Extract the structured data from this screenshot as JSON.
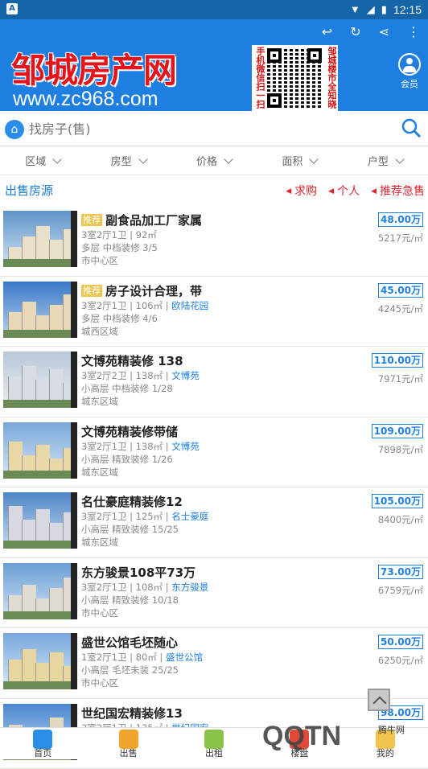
{
  "status_bar": {
    "time": "12:15",
    "app_icon_letter": "A"
  },
  "header": {
    "logo_title": "邹城房产网",
    "logo_url": "www.zc968.com",
    "qr_left_text": "手机微信扫一扫",
    "qr_right_text": "邹城楼市全知晓",
    "member_label": "会员"
  },
  "search": {
    "placeholder": "找房子(售)"
  },
  "filters": [
    "区域",
    "房型",
    "价格",
    "面积",
    "户型"
  ],
  "section": {
    "title": "出售房源",
    "links": [
      "求购",
      "个人",
      "推荐急售"
    ]
  },
  "listings": [
    {
      "tag": "推荐",
      "title": "副食品加工厂家属",
      "line1": "3室2厅1卫 | 92㎡",
      "community": "",
      "line2": "多层 中档装修 3/5",
      "area": "市中心区",
      "price": "48.00万",
      "unit_price": "5217元/㎡"
    },
    {
      "tag": "推荐",
      "title": "房子设计合理，带",
      "line1": "3室2厅1卫 | 106㎡ | ",
      "community": "欧陆花园",
      "line2": "多层 中档装修 4/6",
      "area": "城西区域",
      "price": "45.00万",
      "unit_price": "4245元/㎡"
    },
    {
      "tag": "",
      "title": "文博苑精装修 138",
      "line1": "3室2厅2卫 | 138㎡ | ",
      "community": "文博苑",
      "line2": "小高层 中档装修 1/28",
      "area": "城东区域",
      "price": "110.00万",
      "unit_price": "7971元/㎡"
    },
    {
      "tag": "",
      "title": "文博苑精装修带储",
      "line1": "3室2厅1卫 | 138㎡ | ",
      "community": "文博苑",
      "line2": "小高层 精致装修 1/26",
      "area": "城东区域",
      "price": "109.00万",
      "unit_price": "7898元/㎡"
    },
    {
      "tag": "",
      "title": "名仕豪庭精装修12",
      "line1": "3室2厅1卫 | 125㎡ | ",
      "community": "名士豪庭",
      "line2": "小高层 精致装修 15/25",
      "area": "城东区域",
      "price": "105.00万",
      "unit_price": "8400元/㎡"
    },
    {
      "tag": "",
      "title": "东方骏景108平73万",
      "line1": "3室2厅1卫 | 108㎡ | ",
      "community": "东方骏景",
      "line2": "小高层 精致装修 10/18",
      "area": "市中心区",
      "price": "73.00万",
      "unit_price": "6759元/㎡"
    },
    {
      "tag": "",
      "title": "盛世公馆毛坯随心",
      "line1": "1室2厅1卫 | 80㎡ | ",
      "community": "盛世公馆",
      "line2": "小高层 毛坯未装 25/25",
      "area": "市中心区",
      "price": "50.00万",
      "unit_price": "6250元/㎡"
    },
    {
      "tag": "",
      "title": "世纪国宏精装修13",
      "line1": "3室2厅1卫 | 135㎡ | ",
      "community": "世纪国宏",
      "line2": "",
      "area": "",
      "price": "98.00万",
      "unit_price": ""
    }
  ],
  "tabbar": [
    {
      "label": "首页",
      "color": "#2a8ee8"
    },
    {
      "label": "出售",
      "color": "#f0a62a"
    },
    {
      "label": "出租",
      "color": "#8bc34a"
    },
    {
      "label": "楼盘",
      "color": "#e04a3a"
    },
    {
      "label": "我的",
      "color": "#f0c44f"
    }
  ],
  "watermark": {
    "text": "QQTN",
    "sub": "腾牛网"
  },
  "colors": {
    "primary": "#1e7fe0",
    "logo_red": "#e4141a",
    "tag_yellow": "#f0c44f",
    "alert_red": "#e0252e"
  }
}
